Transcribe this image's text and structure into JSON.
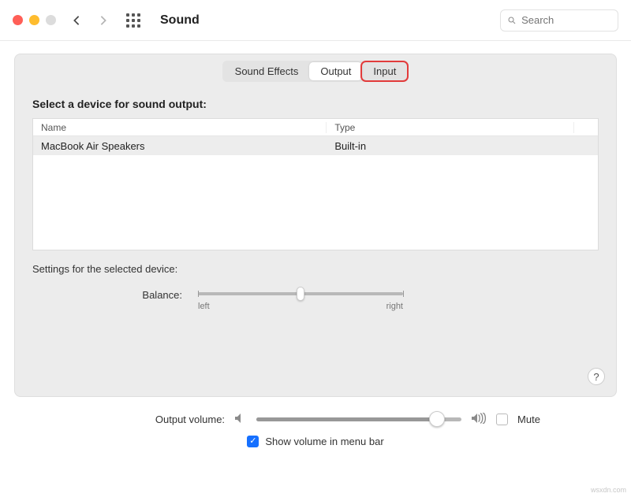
{
  "window": {
    "title": "Sound"
  },
  "search": {
    "placeholder": "Search"
  },
  "tabs": {
    "effects": "Sound Effects",
    "output": "Output",
    "input": "Input",
    "active": "output",
    "highlighted": "input"
  },
  "devices": {
    "heading": "Select a device for sound output:",
    "columns": {
      "name": "Name",
      "type": "Type"
    },
    "rows": [
      {
        "name": "MacBook Air Speakers",
        "type": "Built-in"
      }
    ]
  },
  "settings": {
    "heading": "Settings for the selected device:",
    "balance_label": "Balance:",
    "balance_left": "left",
    "balance_right": "right",
    "balance_value": 50
  },
  "volume": {
    "label": "Output volume:",
    "value": 88,
    "mute_label": "Mute",
    "mute_checked": false
  },
  "menubar": {
    "label": "Show volume in menu bar",
    "checked": true
  },
  "help": "?",
  "watermark": "wsxdn.com"
}
